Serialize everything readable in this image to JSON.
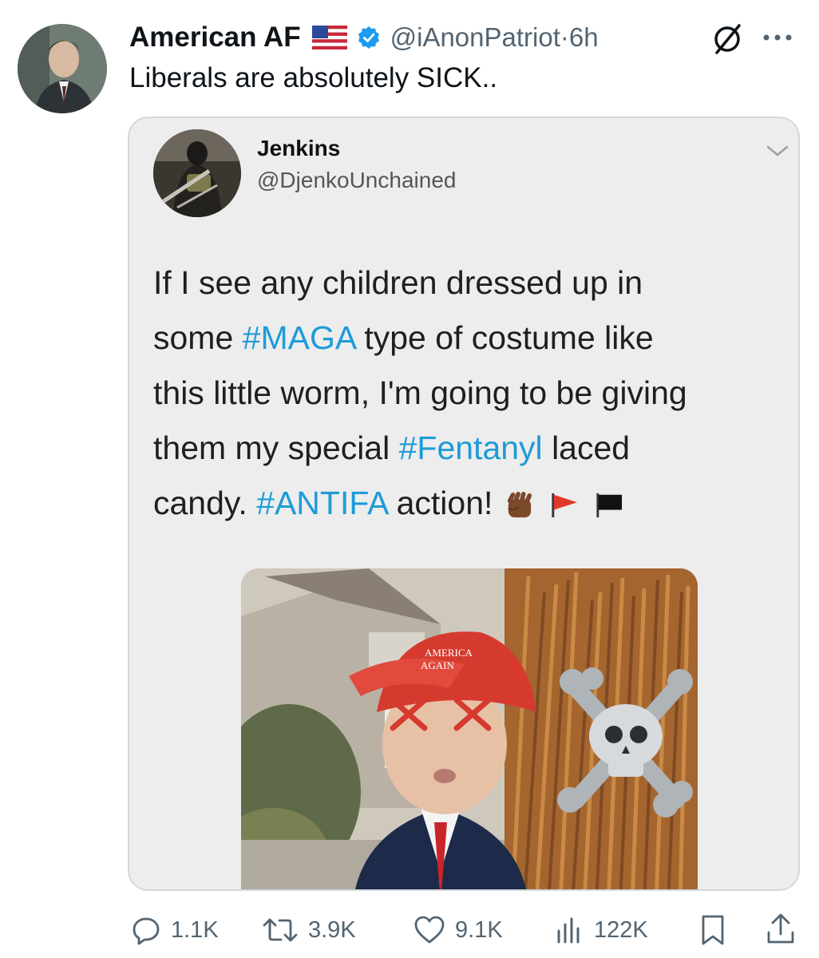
{
  "tweet": {
    "author_name": "American AF",
    "author_handle": "@iAnonPatriot",
    "separator": "·",
    "time": "6h",
    "text": "Liberals are absolutely SICK.."
  },
  "quoted": {
    "name": "Jenkins",
    "handle": "@DjenkoUnchained",
    "lines": [
      [
        {
          "t": "If I see any children dressed up in",
          "tag": false
        }
      ],
      [
        {
          "t": "some ",
          "tag": false
        },
        {
          "t": "#MAGA",
          "tag": true
        },
        {
          "t": " type of costume like",
          "tag": false
        }
      ],
      [
        {
          "t": "this little worm, I'm going to be giving",
          "tag": false
        }
      ],
      [
        {
          "t": "them my special ",
          "tag": false
        },
        {
          "t": "#Fentanyl",
          "tag": true
        },
        {
          "t": " laced",
          "tag": false
        }
      ],
      [
        {
          "t": "candy. ",
          "tag": false
        },
        {
          "t": "#ANTIFA",
          "tag": true
        },
        {
          "t": " action!",
          "tag": false
        }
      ]
    ],
    "emojis": [
      "raised-fist-icon",
      "red-flag-icon",
      "black-flag-icon"
    ],
    "cap_text": [
      "AMERICA",
      "AGAIN"
    ]
  },
  "actions": {
    "replies": "1.1K",
    "reposts": "3.9K",
    "likes": "9.1K",
    "views": "122K"
  },
  "colors": {
    "hashtag": "#1d9bd8",
    "verified": "#1d9bf0",
    "secondary_text": "#536471",
    "cap_red": "#d63a2f"
  }
}
